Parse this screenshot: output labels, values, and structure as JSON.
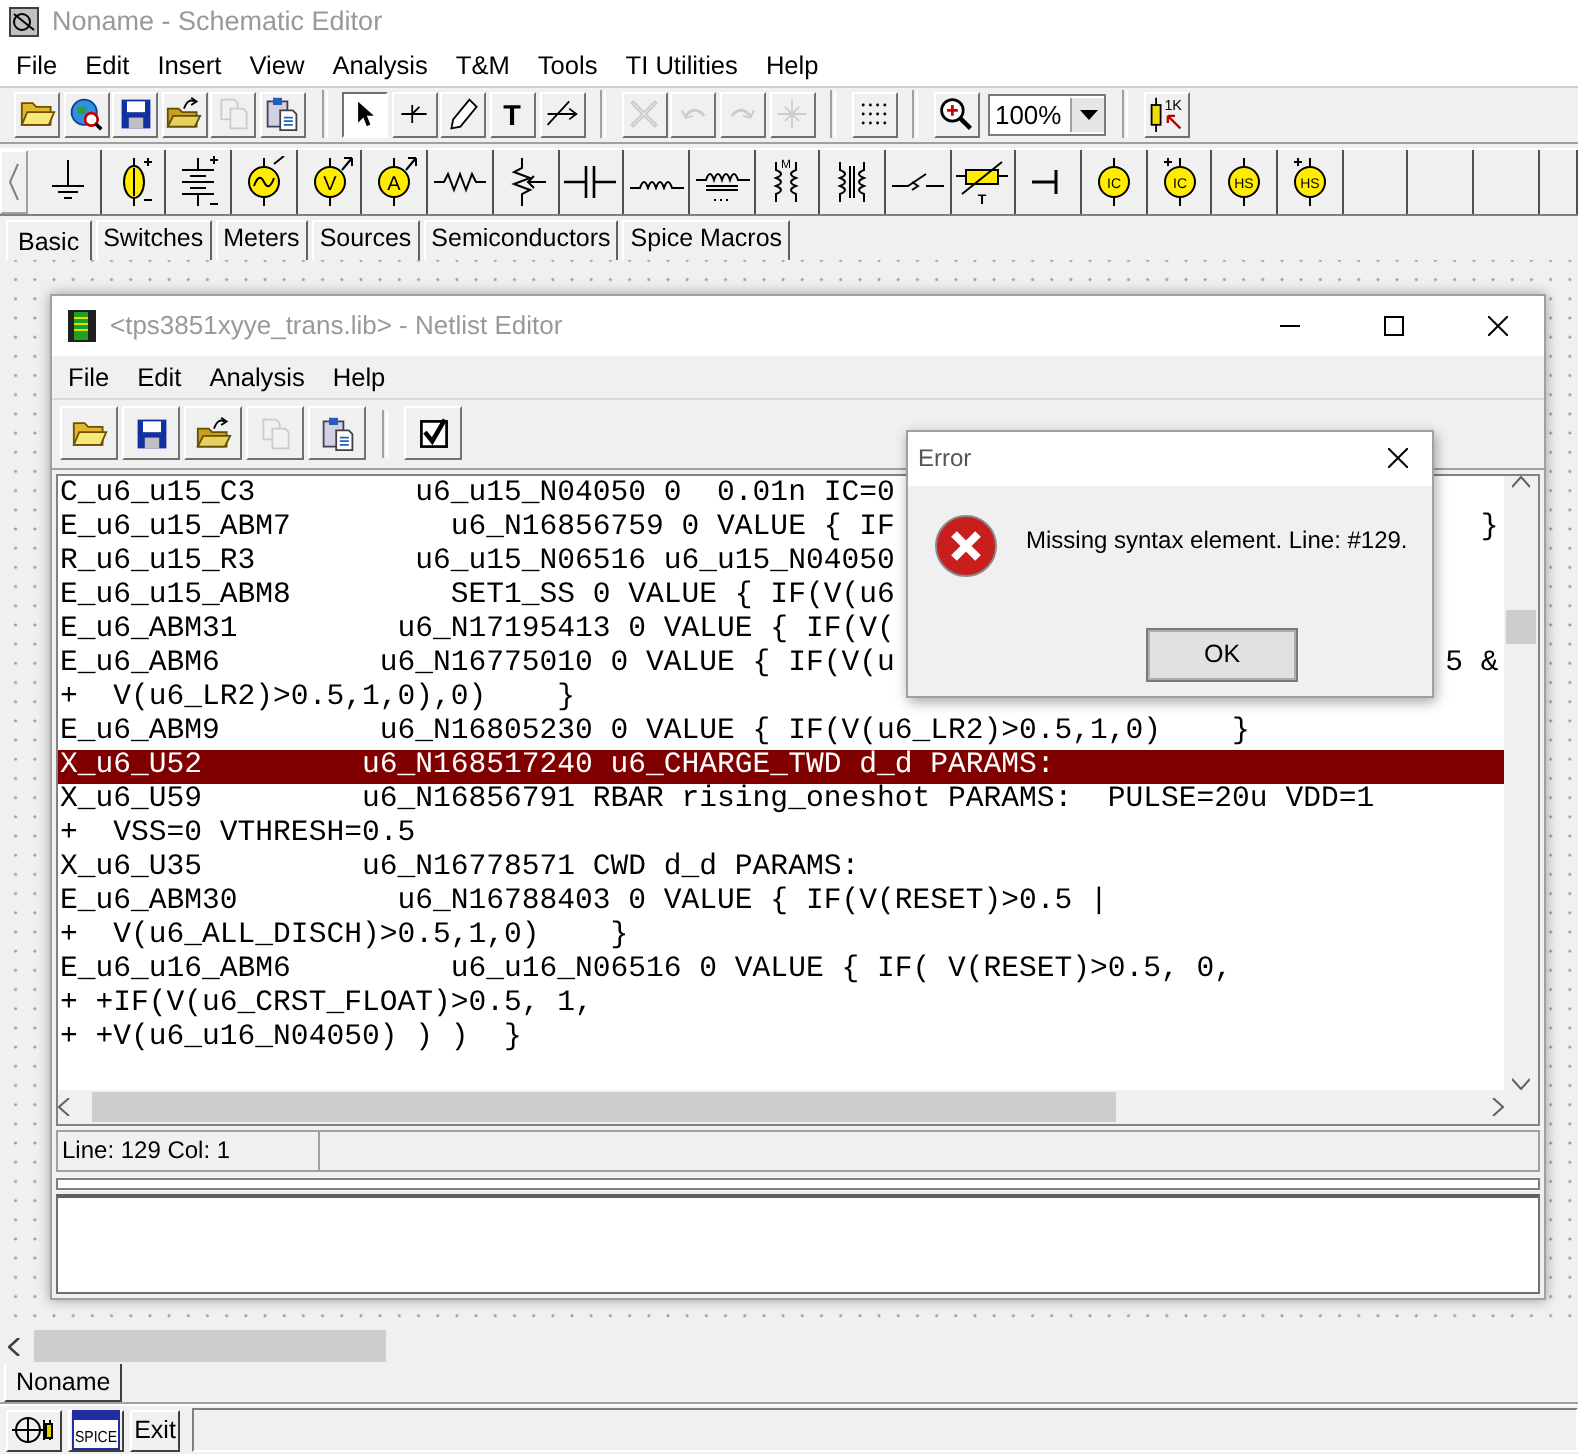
{
  "window": {
    "title": "Noname - Schematic Editor"
  },
  "menu": [
    "File",
    "Edit",
    "Insert",
    "View",
    "Analysis",
    "T&M",
    "Tools",
    "TI Utilities",
    "Help"
  ],
  "toolbar": [
    {
      "kind": "open",
      "disabled": false,
      "pressed": false
    },
    {
      "kind": "web",
      "disabled": false,
      "pressed": false
    },
    {
      "kind": "save",
      "disabled": false,
      "pressed": false
    },
    {
      "kind": "reopen",
      "disabled": false,
      "pressed": false
    },
    {
      "kind": "copy",
      "disabled": true,
      "pressed": false
    },
    {
      "kind": "paste",
      "disabled": false,
      "pressed": false
    },
    {
      "kind": "separator"
    },
    {
      "kind": "select",
      "disabled": false,
      "pressed": true
    },
    {
      "kind": "wire",
      "disabled": false,
      "pressed": false
    },
    {
      "kind": "pencil",
      "disabled": false,
      "pressed": false
    },
    {
      "kind": "text",
      "label": "T",
      "disabled": false,
      "pressed": false
    },
    {
      "kind": "netlabel",
      "disabled": false,
      "pressed": false
    },
    {
      "kind": "separator"
    },
    {
      "kind": "delete",
      "disabled": true,
      "pressed": false
    },
    {
      "kind": "undo",
      "disabled": true,
      "pressed": false
    },
    {
      "kind": "redo",
      "disabled": true,
      "pressed": false
    },
    {
      "kind": "junction",
      "disabled": true,
      "pressed": false
    },
    {
      "kind": "separator"
    },
    {
      "kind": "grid",
      "disabled": false,
      "pressed": false
    },
    {
      "kind": "separator"
    },
    {
      "kind": "zoom",
      "disabled": false,
      "pressed": false
    },
    {
      "kind": "combo",
      "value": "100%"
    },
    {
      "kind": "separator"
    },
    {
      "kind": "resistor-value",
      "label": "1K",
      "disabled": false,
      "pressed": false
    }
  ],
  "parts": [
    {
      "kind": "ground"
    },
    {
      "kind": "dc-source"
    },
    {
      "kind": "battery"
    },
    {
      "kind": "ac-source"
    },
    {
      "kind": "meter",
      "label": "V"
    },
    {
      "kind": "meter",
      "label": "A"
    },
    {
      "kind": "resistor"
    },
    {
      "kind": "potentiometer"
    },
    {
      "kind": "capacitor"
    },
    {
      "kind": "inductor"
    },
    {
      "kind": "core-inductor"
    },
    {
      "kind": "coupled",
      "label": "M"
    },
    {
      "kind": "transformer"
    },
    {
      "kind": "switch"
    },
    {
      "kind": "thermistor",
      "label": "T"
    },
    {
      "kind": "terminal"
    },
    {
      "kind": "round-source",
      "label": "IC"
    },
    {
      "kind": "plus-source",
      "label": "IC"
    },
    {
      "kind": "round-source",
      "label": "HS"
    },
    {
      "kind": "plus-source",
      "label": "HS"
    }
  ],
  "part_tabs": [
    {
      "label": "Basic",
      "selected": true
    },
    {
      "label": "Switches",
      "selected": false
    },
    {
      "label": "Meters",
      "selected": false
    },
    {
      "label": "Sources",
      "selected": false
    },
    {
      "label": "Semiconductors",
      "selected": false
    },
    {
      "label": "Spice Macros",
      "selected": false
    }
  ],
  "netlist_window": {
    "title": "<tps3851xyye_trans.lib> - Netlist Editor",
    "menu": [
      "File",
      "Edit",
      "Analysis",
      "Help"
    ],
    "toolbar": [
      {
        "kind": "open",
        "disabled": false
      },
      {
        "kind": "save",
        "disabled": false
      },
      {
        "kind": "reopen",
        "disabled": false
      },
      {
        "kind": "copy",
        "disabled": true
      },
      {
        "kind": "paste",
        "disabled": false
      },
      {
        "kind": "separator"
      },
      {
        "kind": "check",
        "disabled": false
      }
    ],
    "lines": [
      {
        "text": "C_u6_u15_C3         u6_u15_N04050 0  0.01n IC=0",
        "selected": false
      },
      {
        "text": "E_u6_u15_ABM7         u6_N16856759 0 VALUE { IF",
        "tail": "}",
        "selected": false
      },
      {
        "text": "R_u6_u15_R3         u6_u15_N06516 u6_u15_N04050",
        "selected": false
      },
      {
        "text": "E_u6_u15_ABM8         SET1_SS 0 VALUE { IF(V(u6",
        "selected": false
      },
      {
        "text": "E_u6_ABM31         u6_N17195413 0 VALUE { IF(V(",
        "selected": false
      },
      {
        "text": "E_u6_ABM6         u6_N16775010 0 VALUE { IF(V(u",
        "tail": "5 &",
        "selected": false
      },
      {
        "text": "+  V(u6_LR2)>0.5,1,0),0)    }",
        "selected": false
      },
      {
        "text": "E_u6_ABM9         u6_N16805230 0 VALUE { IF(V(u6_LR2)>0.5,1,0)    }",
        "selected": false
      },
      {
        "text": "X_u6_U52         u6_N168517240 u6_CHARGE_TWD d_d PARAMS:",
        "selected": true
      },
      {
        "text": "X_u6_U59         u6_N16856791 RBAR rising_oneshot PARAMS:  PULSE=20u VDD=1",
        "selected": false
      },
      {
        "text": "+  VSS=0 VTHRESH=0.5",
        "selected": false
      },
      {
        "text": "X_u6_U35         u6_N16778571 CWD d_d PARAMS:",
        "selected": false
      },
      {
        "text": "E_u6_ABM30         u6_N16788403 0 VALUE { IF(V(RESET)>0.5 |",
        "selected": false
      },
      {
        "text": "+  V(u6_ALL_DISCH)>0.5,1,0)    }",
        "selected": false
      },
      {
        "text": "E_u6_u16_ABM6         u6_u16_N06516 0 VALUE { IF( V(RESET)>0.5, 0,",
        "selected": false
      },
      {
        "text": "+ +IF(V(u6_CRST_FLOAT)>0.5, 1,",
        "selected": false
      },
      {
        "text": "+ +V(u6_u16_N04050) ) )  }",
        "selected": false
      }
    ],
    "status": "Line: 129 Col: 1"
  },
  "error_dialog": {
    "title": "Error",
    "message": "Missing syntax element. Line: #129.",
    "button": "OK"
  },
  "document_tabs": [
    {
      "label": "Noname",
      "selected": true
    }
  ],
  "taskbar": [
    {
      "kind": "schematic"
    },
    {
      "kind": "spice",
      "label": "SPICE"
    },
    {
      "kind": "exit",
      "label": "Exit"
    }
  ]
}
